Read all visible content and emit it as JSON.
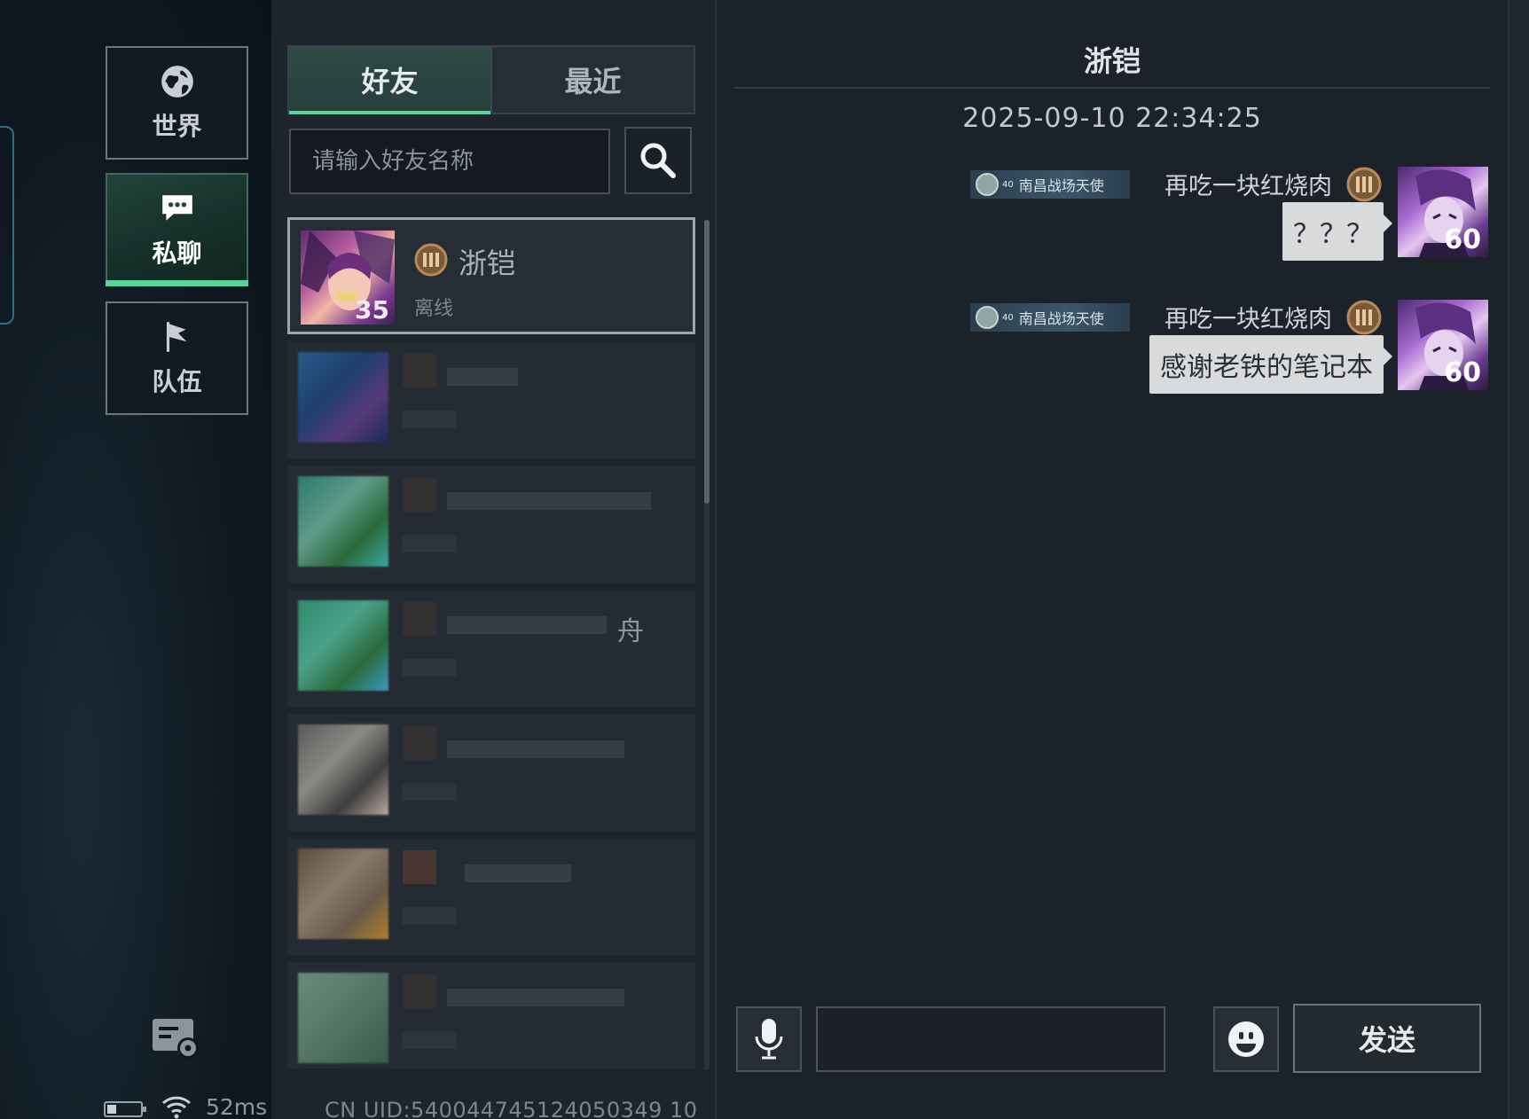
{
  "rail": {
    "channels": [
      {
        "label": "世界",
        "icon": "globe-icon",
        "active": false
      },
      {
        "label": "私聊",
        "icon": "chat-bubble-icon",
        "active": true
      },
      {
        "label": "队伍",
        "icon": "flag-icon",
        "active": false
      }
    ],
    "ping": "52ms",
    "accent": "#58d39b"
  },
  "friends": {
    "tabs": [
      {
        "label": "好友",
        "active": true
      },
      {
        "label": "最近",
        "active": false
      }
    ],
    "search_placeholder": "请输入好友名称",
    "selected": {
      "name": "浙铠",
      "status": "离线",
      "level": "35",
      "rank_icon": "rank-iii-icon"
    },
    "partial_text_1": "舟",
    "uid": "CN UID:540044745124050349 10"
  },
  "chat": {
    "title": "浙铠",
    "timestamp": "2025-09-10 22:34:25",
    "messages": [
      {
        "badge_level": "40",
        "badge_text": "南昌战场天使",
        "sender": "再吃一块红烧肉",
        "text": "？？？",
        "level": "60"
      },
      {
        "badge_level": "40",
        "badge_text": "南昌战场天使",
        "sender": "再吃一块红烧肉",
        "text": "感谢老铁的笔记本",
        "level": "60"
      }
    ],
    "input_value": "",
    "send_label": "发送"
  }
}
